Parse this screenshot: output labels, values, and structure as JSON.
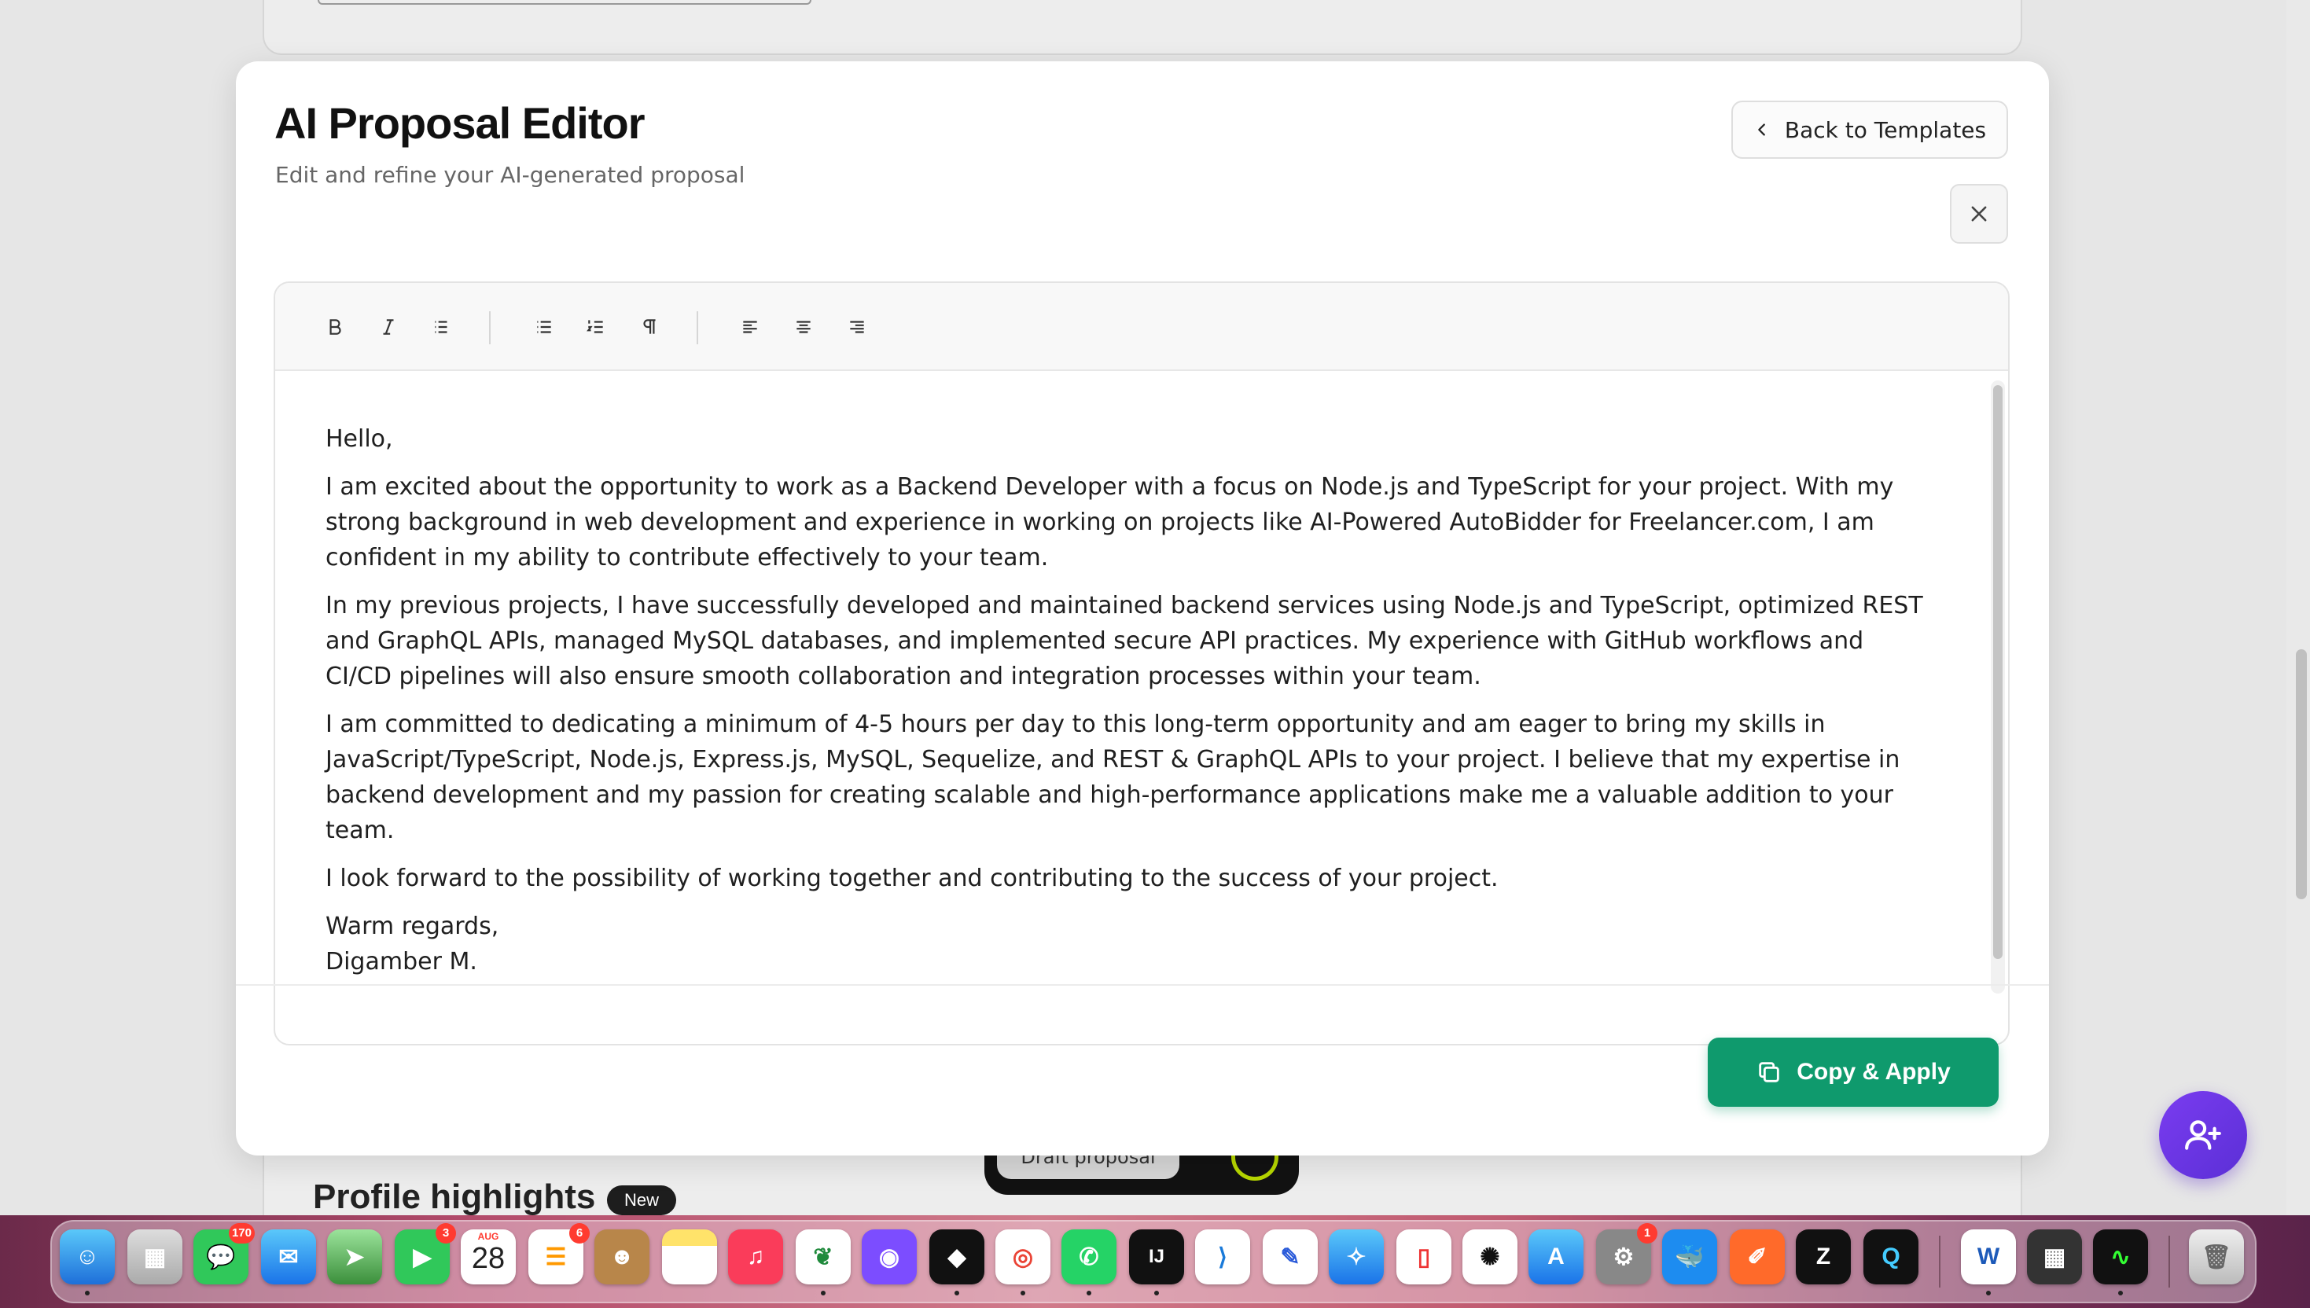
{
  "background": {
    "section_heading": "Profile highlights",
    "section_badge": "New",
    "floating_pill_button": "Draft proposal"
  },
  "modal": {
    "title": "AI Proposal Editor",
    "subtitle": "Edit and refine your AI-generated proposal",
    "back_button": "Back to Templates",
    "close_icon": "close-icon"
  },
  "toolbar": {
    "buttons": [
      "bold-icon",
      "italic-icon",
      "list-icon",
      "bullet-list-icon",
      "ordered-list-icon",
      "pilcrow-icon",
      "align-left-icon",
      "align-center-icon",
      "align-right-icon"
    ]
  },
  "proposal": {
    "greeting": "Hello,",
    "paragraphs": [
      "I am excited about the opportunity to work as a Backend Developer with a focus on Node.js and TypeScript for your project. With my strong background in web development and experience in working on projects like AI-Powered AutoBidder for Freelancer.com, I am confident in my ability to contribute effectively to your team.",
      "In my previous projects, I have successfully developed and maintained backend services using Node.js and TypeScript, optimized REST and GraphQL APIs, managed MySQL databases, and implemented secure API practices. My experience with GitHub workflows and CI/CD pipelines will also ensure smooth collaboration and integration processes within your team.",
      "I am committed to dedicating a minimum of 4-5 hours per day to this long-term opportunity and am eager to bring my skills in JavaScript/TypeScript, Node.js, Express.js, MySQL, Sequelize, and REST & GraphQL APIs to your project. I believe that my expertise in backend development and my passion for creating scalable and high-performance applications make me a valuable addition to your team.",
      "I look forward to the possibility of working together and contributing to the success of your project."
    ],
    "closing": "Warm regards,",
    "signature": "Digamber M."
  },
  "footer": {
    "copy_button": "Copy & Apply"
  },
  "fab": {
    "icon": "add-user-icon"
  },
  "dock": {
    "messages_badge": "170",
    "facetime_badge": "3",
    "calendar_month": "AUG",
    "calendar_day": "28",
    "reminders_badge": "6",
    "settings_badge": "1",
    "jetbrains_label": "IJ"
  },
  "colors": {
    "accent_green": "#0f9a6d",
    "fab_purple": "#6a36e6",
    "badge_dark": "#1d1d1d"
  }
}
